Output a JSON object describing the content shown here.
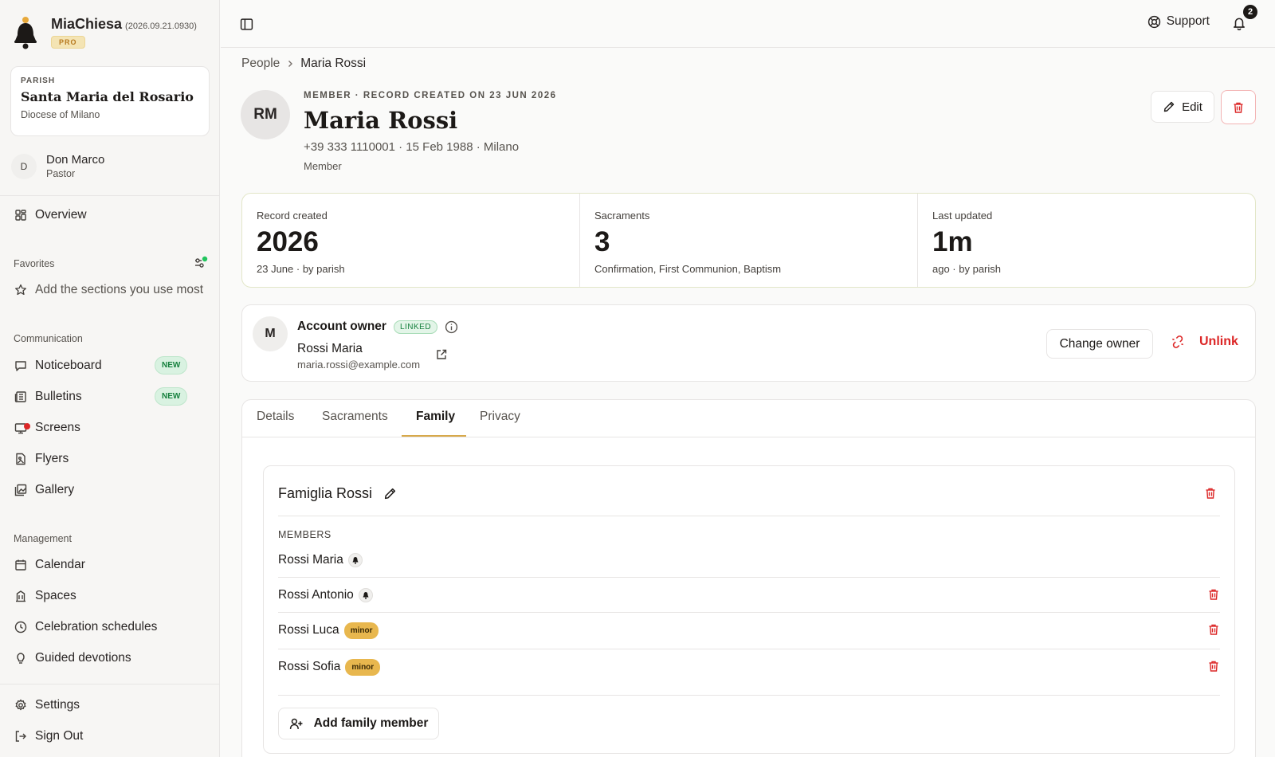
{
  "app": {
    "name": "MiaChiesa",
    "version": "(2026.09.21.0930)",
    "plan": "PRO"
  },
  "parish": {
    "kicker": "PARISH",
    "name": "Santa Maria del Rosario",
    "diocese": "Diocese of Milano"
  },
  "user": {
    "initial": "D",
    "name": "Don Marco",
    "role": "Pastor"
  },
  "nav": {
    "overview": "Overview",
    "favorites_title": "Favorites",
    "favorites_hint": "Add the sections you use most",
    "communication_title": "Communication",
    "noticeboard": "Noticeboard",
    "bulletins": "Bulletins",
    "screens": "Screens",
    "flyers": "Flyers",
    "gallery": "Gallery",
    "new_badge": "NEW",
    "management_title": "Management",
    "calendar": "Calendar",
    "spaces": "Spaces",
    "celebration_schedules": "Celebration schedules",
    "guided_devotions": "Guided devotions",
    "settings": "Settings",
    "sign_out": "Sign Out"
  },
  "topbar": {
    "support": "Support",
    "notifications_count": "2"
  },
  "breadcrumb": {
    "parent": "People",
    "current": "Maria Rossi"
  },
  "person": {
    "initials": "RM",
    "kicker": "MEMBER · RECORD CREATED ON 23 JUN 2026",
    "name": "Maria Rossi",
    "details": "+39 333 1110001 · 15 Feb 1988 · Milano",
    "role": "Member",
    "edit_label": "Edit"
  },
  "stats": [
    {
      "label": "Record created",
      "value": "2026",
      "sub": "23 June · by parish"
    },
    {
      "label": "Sacraments",
      "value": "3",
      "sub": "Confirmation, First Communion, Baptism"
    },
    {
      "label": "Last updated",
      "value": "1m",
      "sub": "ago · by parish"
    }
  ],
  "owner": {
    "initial": "M",
    "title": "Account owner",
    "status": "LINKED",
    "name": "Rossi Maria",
    "email": "maria.rossi@example.com",
    "change_label": "Change owner",
    "unlink_label": "Unlink"
  },
  "tabs": [
    "Details",
    "Sacraments",
    "Family",
    "Privacy"
  ],
  "active_tab": "Family",
  "family": {
    "name": "Famiglia Rossi",
    "members_label": "MEMBERS",
    "members": [
      {
        "name": "Rossi Maria",
        "badge": "account-icon"
      },
      {
        "name": "Rossi Antonio",
        "badge": "account-icon"
      },
      {
        "name": "Rossi Luca",
        "badge": "minor"
      },
      {
        "name": "Rossi Sofia",
        "badge": "minor"
      }
    ],
    "add_label": "Add family member"
  },
  "colors": {
    "accent": "#d7a94b",
    "danger": "#dc2626",
    "success": "#15803d",
    "minor_badge": "#e8b74e"
  }
}
